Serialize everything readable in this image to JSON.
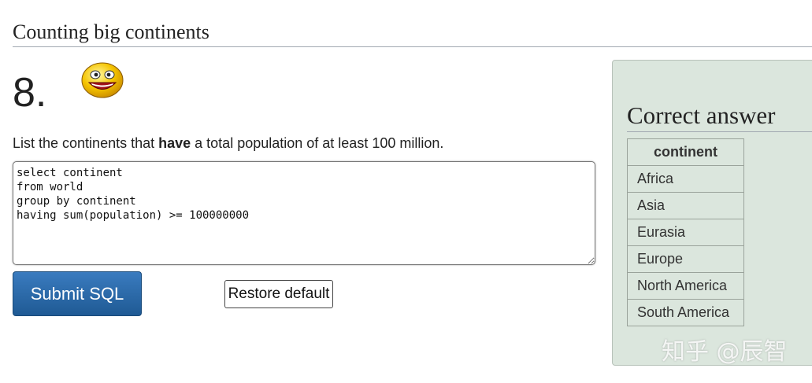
{
  "page": {
    "section_title": "Counting big continents"
  },
  "question": {
    "number": "8.",
    "text_before": "List the continents that ",
    "text_bold": "have",
    "text_after": " a total population of at least 100 million.",
    "smiley_icon": "smiley-face-icon"
  },
  "editor": {
    "sql": "select continent\nfrom world\ngroup by continent\nhaving sum(population) >= 100000000"
  },
  "buttons": {
    "submit_label": "Submit SQL",
    "restore_label": "Restore default"
  },
  "answer": {
    "title": "Correct answer",
    "column_header": "continent",
    "rows": [
      "Africa",
      "Asia",
      "Eurasia",
      "Europe",
      "North America",
      "South America"
    ]
  },
  "watermark": "知乎 @辰智",
  "colors": {
    "submit_bg": "#2a6aa8",
    "answer_panel_bg": "#dbe6dd"
  }
}
